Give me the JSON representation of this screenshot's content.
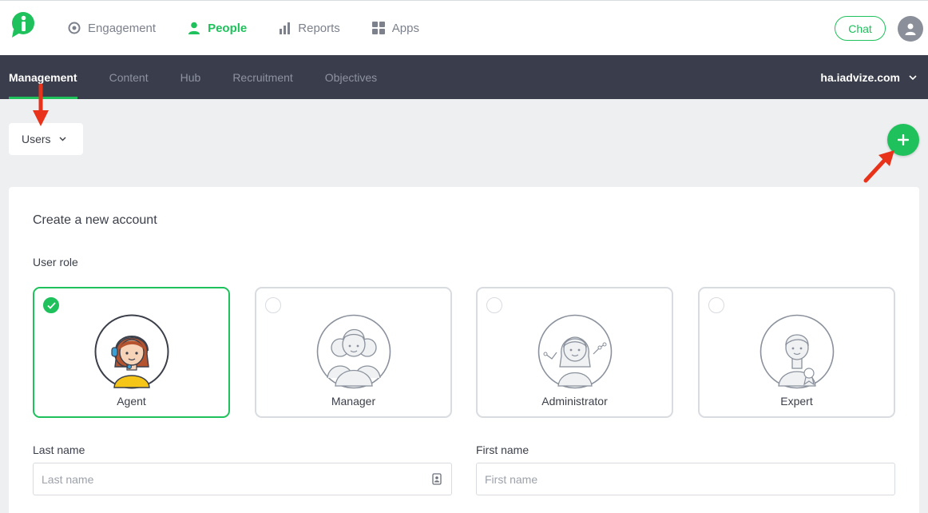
{
  "top_nav": {
    "items": [
      {
        "label": "Engagement",
        "icon": "target-icon"
      },
      {
        "label": "People",
        "icon": "person-icon",
        "active": true
      },
      {
        "label": "Reports",
        "icon": "bar-chart-icon"
      },
      {
        "label": "Apps",
        "icon": "grid-icon"
      }
    ],
    "chat_label": "Chat"
  },
  "sub_nav": {
    "items": [
      {
        "label": "Management",
        "active": true
      },
      {
        "label": "Content"
      },
      {
        "label": "Hub"
      },
      {
        "label": "Recruitment"
      },
      {
        "label": "Objectives"
      }
    ],
    "domain": "ha.iadvize.com"
  },
  "users_dropdown": {
    "label": "Users"
  },
  "form": {
    "title": "Create a new account",
    "role_label": "User role",
    "roles": [
      {
        "name": "Agent",
        "selected": true
      },
      {
        "name": "Manager",
        "selected": false
      },
      {
        "name": "Administrator",
        "selected": false
      },
      {
        "name": "Expert",
        "selected": false
      }
    ],
    "last_name": {
      "label": "Last name",
      "placeholder": "Last name",
      "value": ""
    },
    "first_name": {
      "label": "First name",
      "placeholder": "First name",
      "value": ""
    }
  },
  "colors": {
    "accent": "#1ec15b",
    "subnav_bg": "#3a3e4c",
    "annotation_arrow": "#e8321a"
  }
}
